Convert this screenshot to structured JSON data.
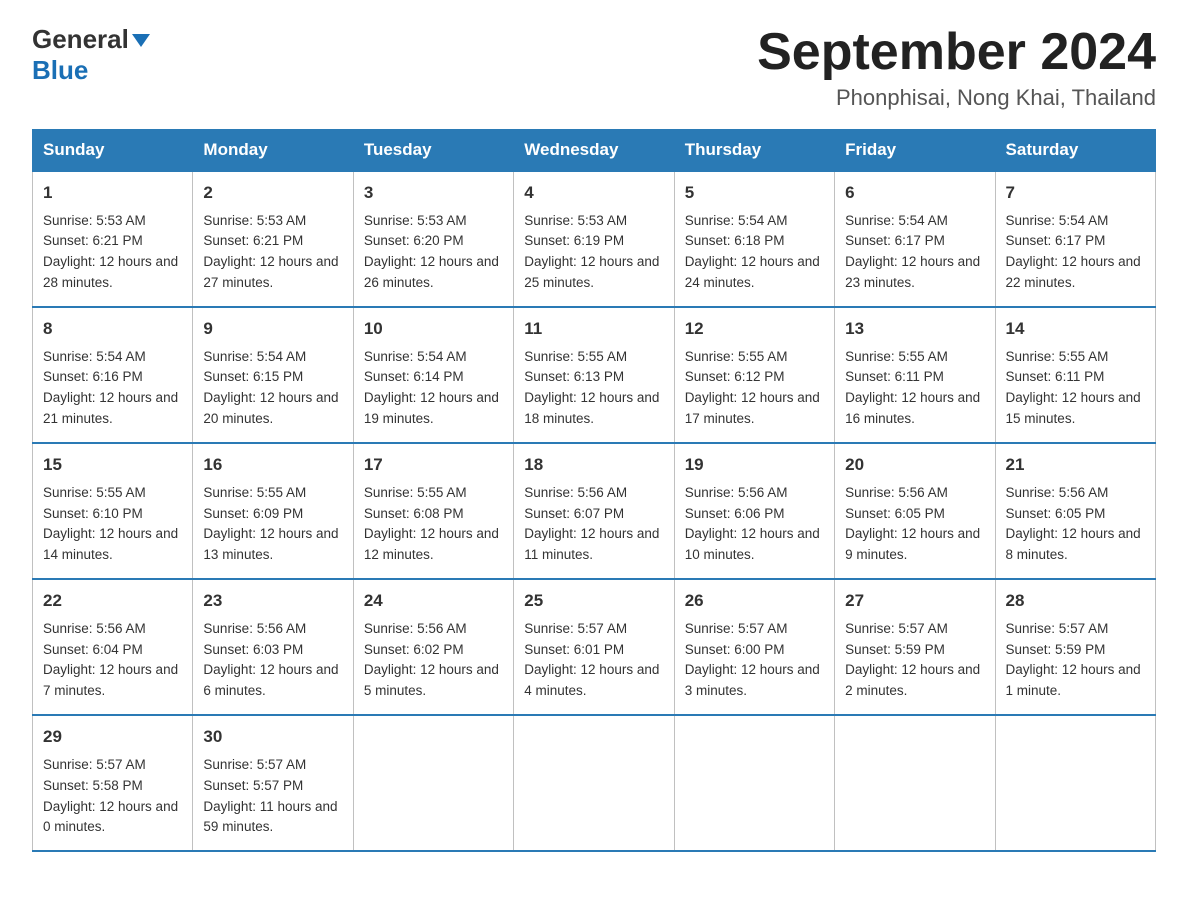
{
  "header": {
    "logo_general": "General",
    "logo_blue": "Blue",
    "title": "September 2024",
    "subtitle": "Phonphisai, Nong Khai, Thailand"
  },
  "days_of_week": [
    "Sunday",
    "Monday",
    "Tuesday",
    "Wednesday",
    "Thursday",
    "Friday",
    "Saturday"
  ],
  "weeks": [
    [
      {
        "day": "1",
        "sunrise": "Sunrise: 5:53 AM",
        "sunset": "Sunset: 6:21 PM",
        "daylight": "Daylight: 12 hours and 28 minutes."
      },
      {
        "day": "2",
        "sunrise": "Sunrise: 5:53 AM",
        "sunset": "Sunset: 6:21 PM",
        "daylight": "Daylight: 12 hours and 27 minutes."
      },
      {
        "day": "3",
        "sunrise": "Sunrise: 5:53 AM",
        "sunset": "Sunset: 6:20 PM",
        "daylight": "Daylight: 12 hours and 26 minutes."
      },
      {
        "day": "4",
        "sunrise": "Sunrise: 5:53 AM",
        "sunset": "Sunset: 6:19 PM",
        "daylight": "Daylight: 12 hours and 25 minutes."
      },
      {
        "day": "5",
        "sunrise": "Sunrise: 5:54 AM",
        "sunset": "Sunset: 6:18 PM",
        "daylight": "Daylight: 12 hours and 24 minutes."
      },
      {
        "day": "6",
        "sunrise": "Sunrise: 5:54 AM",
        "sunset": "Sunset: 6:17 PM",
        "daylight": "Daylight: 12 hours and 23 minutes."
      },
      {
        "day": "7",
        "sunrise": "Sunrise: 5:54 AM",
        "sunset": "Sunset: 6:17 PM",
        "daylight": "Daylight: 12 hours and 22 minutes."
      }
    ],
    [
      {
        "day": "8",
        "sunrise": "Sunrise: 5:54 AM",
        "sunset": "Sunset: 6:16 PM",
        "daylight": "Daylight: 12 hours and 21 minutes."
      },
      {
        "day": "9",
        "sunrise": "Sunrise: 5:54 AM",
        "sunset": "Sunset: 6:15 PM",
        "daylight": "Daylight: 12 hours and 20 minutes."
      },
      {
        "day": "10",
        "sunrise": "Sunrise: 5:54 AM",
        "sunset": "Sunset: 6:14 PM",
        "daylight": "Daylight: 12 hours and 19 minutes."
      },
      {
        "day": "11",
        "sunrise": "Sunrise: 5:55 AM",
        "sunset": "Sunset: 6:13 PM",
        "daylight": "Daylight: 12 hours and 18 minutes."
      },
      {
        "day": "12",
        "sunrise": "Sunrise: 5:55 AM",
        "sunset": "Sunset: 6:12 PM",
        "daylight": "Daylight: 12 hours and 17 minutes."
      },
      {
        "day": "13",
        "sunrise": "Sunrise: 5:55 AM",
        "sunset": "Sunset: 6:11 PM",
        "daylight": "Daylight: 12 hours and 16 minutes."
      },
      {
        "day": "14",
        "sunrise": "Sunrise: 5:55 AM",
        "sunset": "Sunset: 6:11 PM",
        "daylight": "Daylight: 12 hours and 15 minutes."
      }
    ],
    [
      {
        "day": "15",
        "sunrise": "Sunrise: 5:55 AM",
        "sunset": "Sunset: 6:10 PM",
        "daylight": "Daylight: 12 hours and 14 minutes."
      },
      {
        "day": "16",
        "sunrise": "Sunrise: 5:55 AM",
        "sunset": "Sunset: 6:09 PM",
        "daylight": "Daylight: 12 hours and 13 minutes."
      },
      {
        "day": "17",
        "sunrise": "Sunrise: 5:55 AM",
        "sunset": "Sunset: 6:08 PM",
        "daylight": "Daylight: 12 hours and 12 minutes."
      },
      {
        "day": "18",
        "sunrise": "Sunrise: 5:56 AM",
        "sunset": "Sunset: 6:07 PM",
        "daylight": "Daylight: 12 hours and 11 minutes."
      },
      {
        "day": "19",
        "sunrise": "Sunrise: 5:56 AM",
        "sunset": "Sunset: 6:06 PM",
        "daylight": "Daylight: 12 hours and 10 minutes."
      },
      {
        "day": "20",
        "sunrise": "Sunrise: 5:56 AM",
        "sunset": "Sunset: 6:05 PM",
        "daylight": "Daylight: 12 hours and 9 minutes."
      },
      {
        "day": "21",
        "sunrise": "Sunrise: 5:56 AM",
        "sunset": "Sunset: 6:05 PM",
        "daylight": "Daylight: 12 hours and 8 minutes."
      }
    ],
    [
      {
        "day": "22",
        "sunrise": "Sunrise: 5:56 AM",
        "sunset": "Sunset: 6:04 PM",
        "daylight": "Daylight: 12 hours and 7 minutes."
      },
      {
        "day": "23",
        "sunrise": "Sunrise: 5:56 AM",
        "sunset": "Sunset: 6:03 PM",
        "daylight": "Daylight: 12 hours and 6 minutes."
      },
      {
        "day": "24",
        "sunrise": "Sunrise: 5:56 AM",
        "sunset": "Sunset: 6:02 PM",
        "daylight": "Daylight: 12 hours and 5 minutes."
      },
      {
        "day": "25",
        "sunrise": "Sunrise: 5:57 AM",
        "sunset": "Sunset: 6:01 PM",
        "daylight": "Daylight: 12 hours and 4 minutes."
      },
      {
        "day": "26",
        "sunrise": "Sunrise: 5:57 AM",
        "sunset": "Sunset: 6:00 PM",
        "daylight": "Daylight: 12 hours and 3 minutes."
      },
      {
        "day": "27",
        "sunrise": "Sunrise: 5:57 AM",
        "sunset": "Sunset: 5:59 PM",
        "daylight": "Daylight: 12 hours and 2 minutes."
      },
      {
        "day": "28",
        "sunrise": "Sunrise: 5:57 AM",
        "sunset": "Sunset: 5:59 PM",
        "daylight": "Daylight: 12 hours and 1 minute."
      }
    ],
    [
      {
        "day": "29",
        "sunrise": "Sunrise: 5:57 AM",
        "sunset": "Sunset: 5:58 PM",
        "daylight": "Daylight: 12 hours and 0 minutes."
      },
      {
        "day": "30",
        "sunrise": "Sunrise: 5:57 AM",
        "sunset": "Sunset: 5:57 PM",
        "daylight": "Daylight: 11 hours and 59 minutes."
      },
      null,
      null,
      null,
      null,
      null
    ]
  ]
}
